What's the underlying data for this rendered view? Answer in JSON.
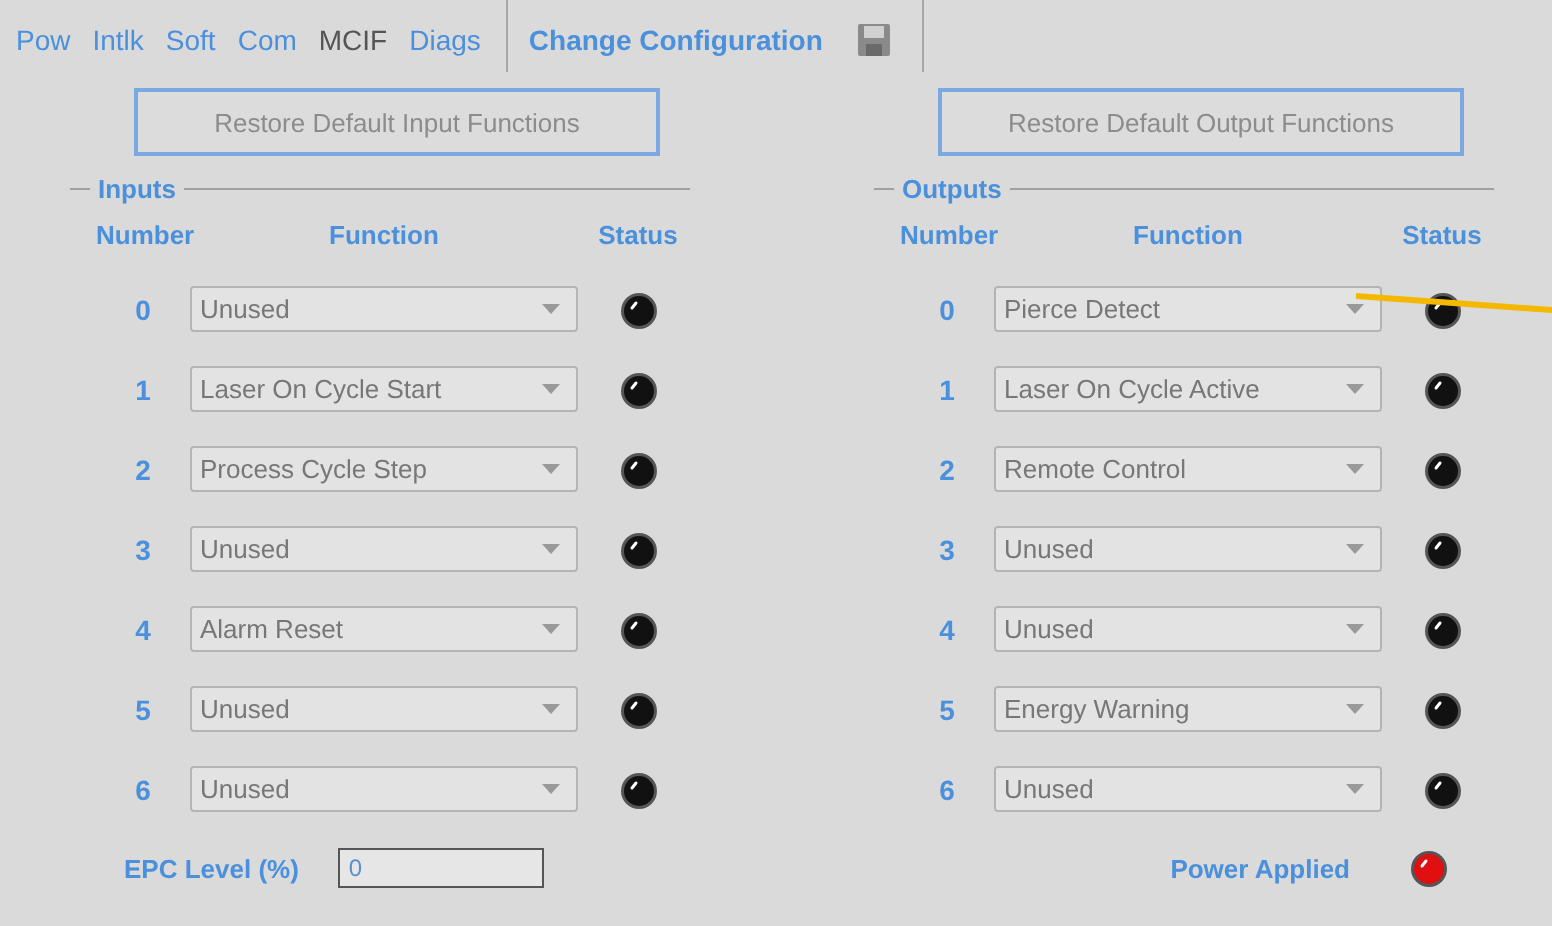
{
  "nav": {
    "tabs": [
      {
        "label": "Pow",
        "selected": false
      },
      {
        "label": "Intlk",
        "selected": false
      },
      {
        "label": "Soft",
        "selected": false
      },
      {
        "label": "Com",
        "selected": false
      },
      {
        "label": "MCIF",
        "selected": true
      },
      {
        "label": "Diags",
        "selected": false
      }
    ],
    "action": "Change Configuration"
  },
  "inputs": {
    "button": "Restore Default Input Functions",
    "title": "Inputs",
    "headers": [
      "Number",
      "Function",
      "Status"
    ],
    "rows": [
      {
        "number": "0",
        "function": "Unused",
        "on": false
      },
      {
        "number": "1",
        "function": "Laser On Cycle Start",
        "on": false
      },
      {
        "number": "2",
        "function": "Process Cycle Step",
        "on": false
      },
      {
        "number": "3",
        "function": "Unused",
        "on": false
      },
      {
        "number": "4",
        "function": "Alarm Reset",
        "on": false
      },
      {
        "number": "5",
        "function": "Unused",
        "on": false
      },
      {
        "number": "6",
        "function": "Unused",
        "on": false
      }
    ]
  },
  "outputs": {
    "button": "Restore Default Output Functions",
    "title": "Outputs",
    "headers": [
      "Number",
      "Function",
      "Status"
    ],
    "rows": [
      {
        "number": "0",
        "function": "Pierce Detect",
        "on": false
      },
      {
        "number": "1",
        "function": "Laser On Cycle Active",
        "on": false
      },
      {
        "number": "2",
        "function": "Remote Control",
        "on": false
      },
      {
        "number": "3",
        "function": "Unused",
        "on": false
      },
      {
        "number": "4",
        "function": "Unused",
        "on": false
      },
      {
        "number": "5",
        "function": "Energy Warning",
        "on": false
      },
      {
        "number": "6",
        "function": "Unused",
        "on": false
      }
    ]
  },
  "epc": {
    "label": "EPC Level (%)",
    "value": "0"
  },
  "power": {
    "label": "Power Applied",
    "on": true
  }
}
